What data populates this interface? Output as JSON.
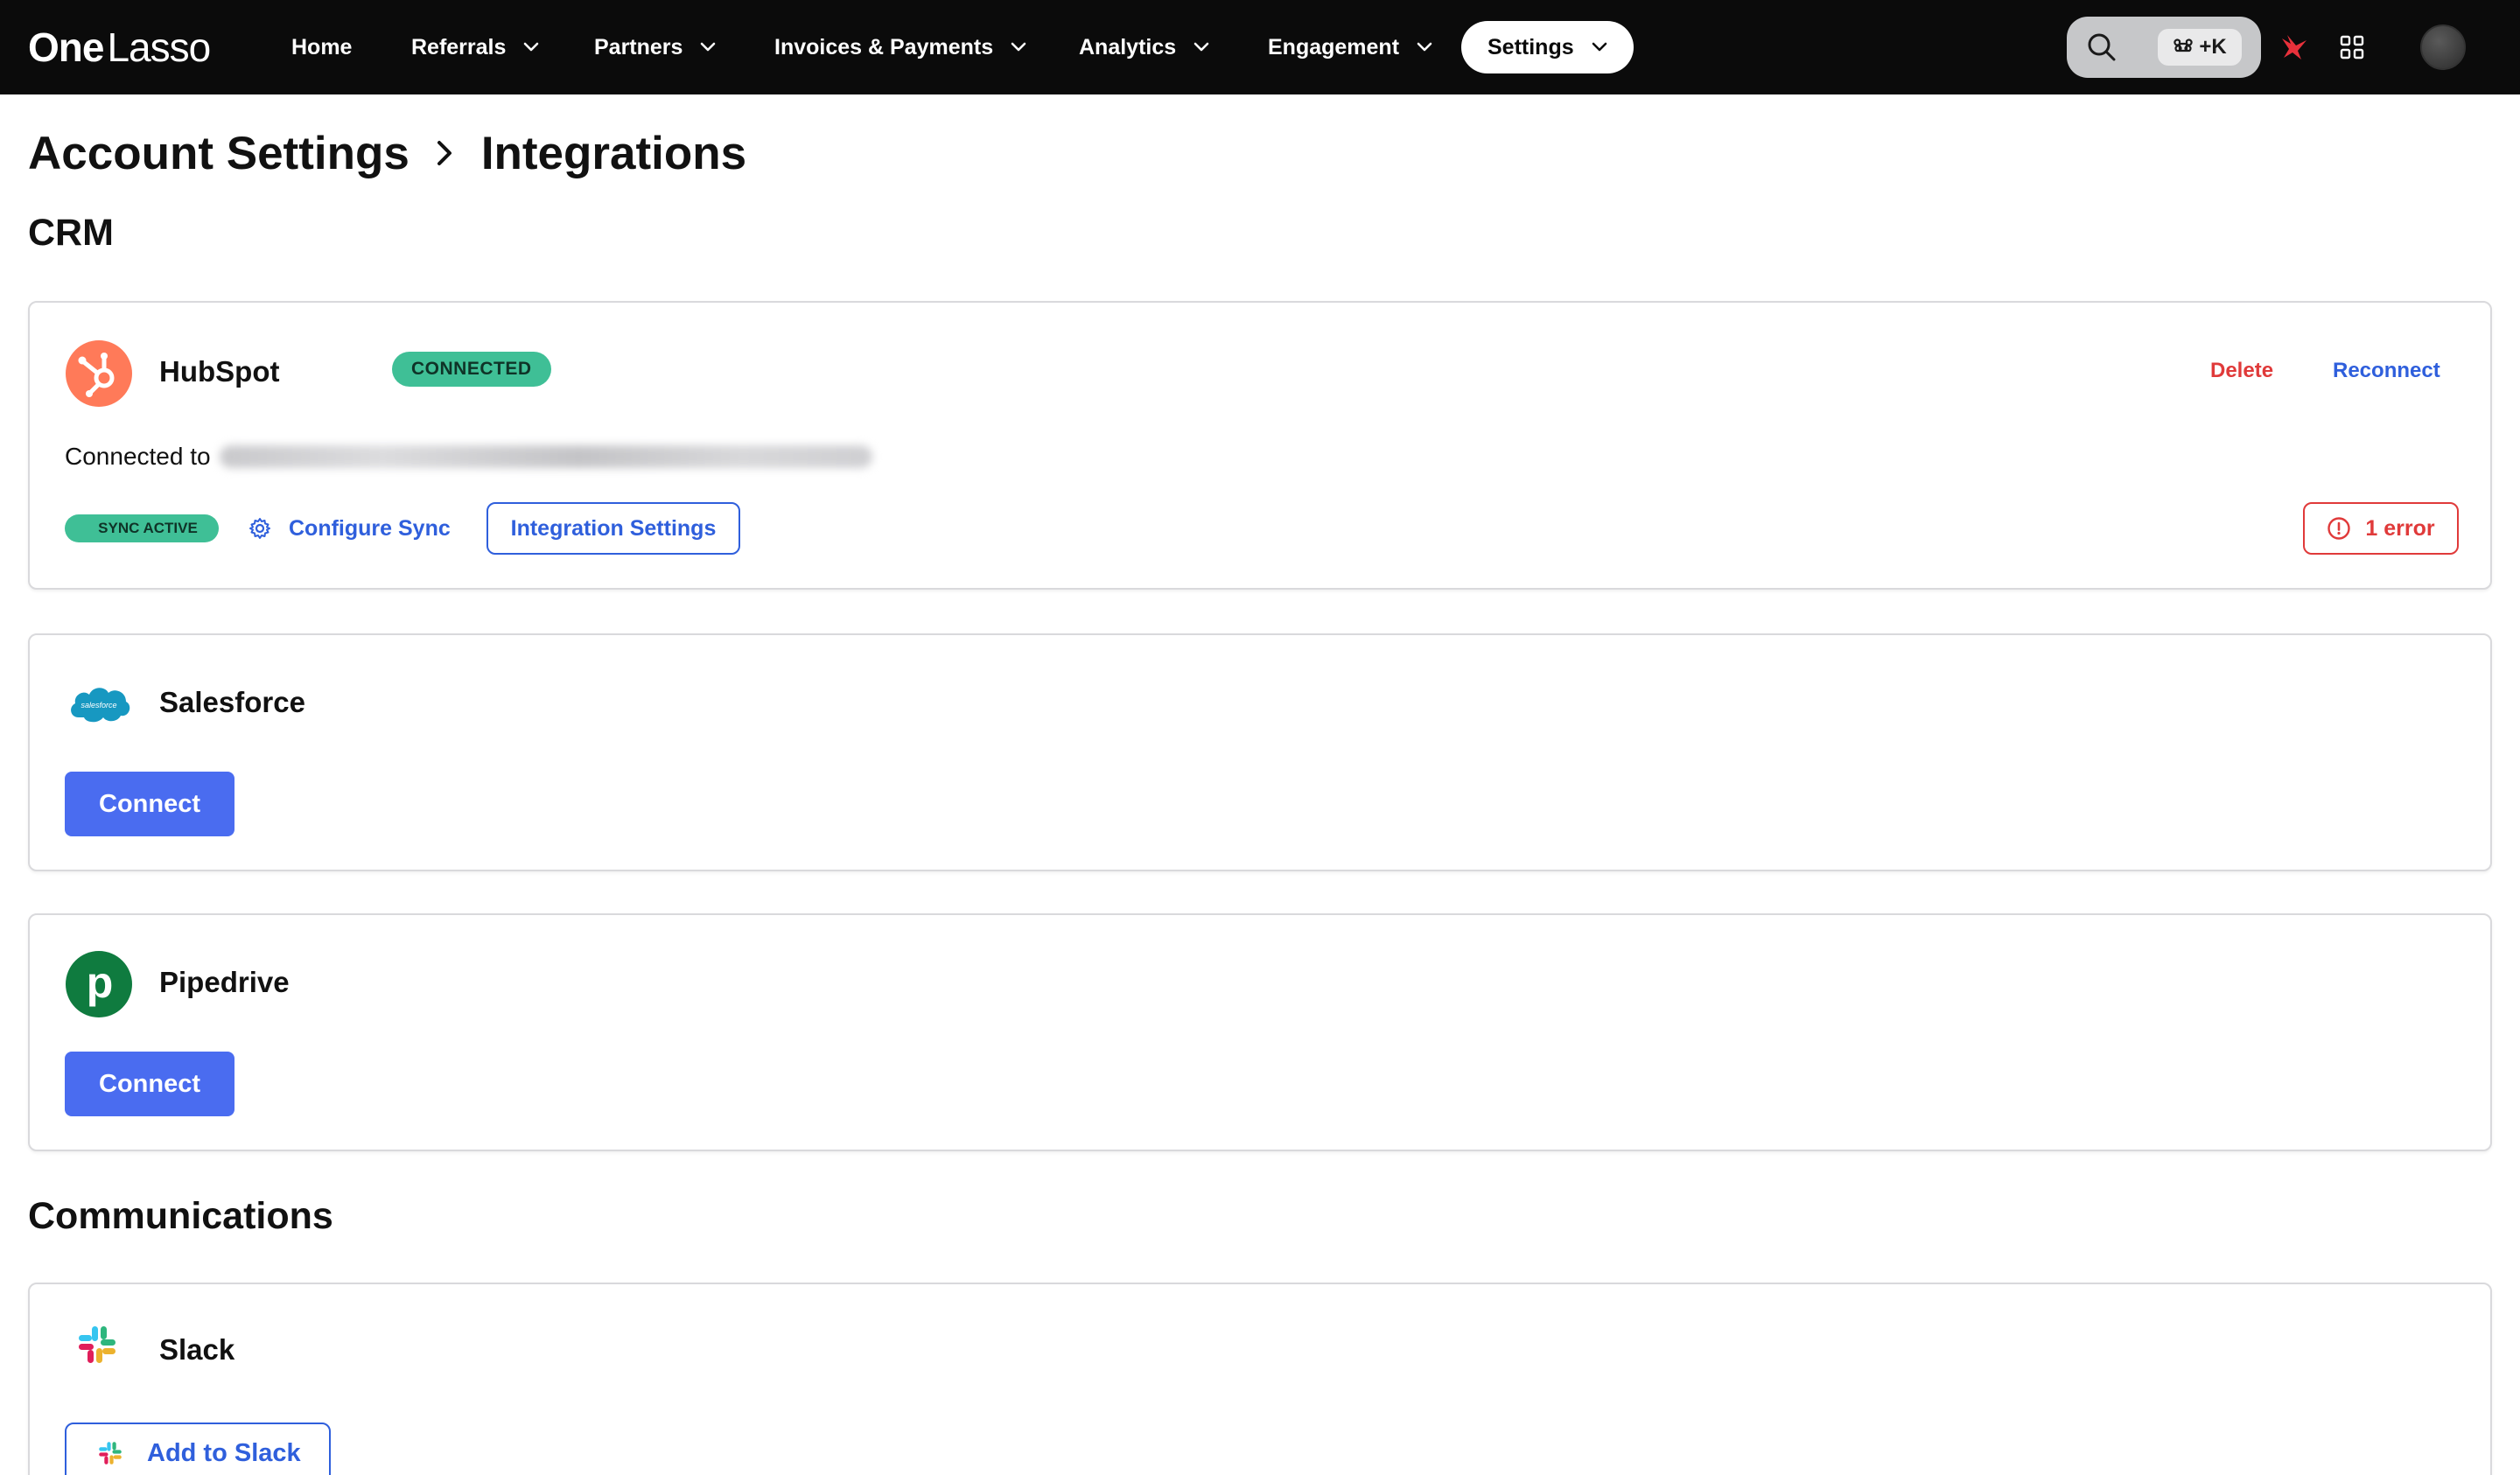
{
  "app": {
    "logo_one": "One",
    "logo_lasso": "Lasso"
  },
  "nav": {
    "items": [
      {
        "label": "Home",
        "has_menu": false
      },
      {
        "label": "Referrals",
        "has_menu": true
      },
      {
        "label": "Partners",
        "has_menu": true
      },
      {
        "label": "Invoices & Payments",
        "has_menu": true
      },
      {
        "label": "Analytics",
        "has_menu": true
      },
      {
        "label": "Engagement",
        "has_menu": true
      },
      {
        "label": "Settings",
        "has_menu": true,
        "active": true
      }
    ],
    "search_shortcut": "+K",
    "icons": [
      "search-icon",
      "command-icon",
      "notification-bird-icon",
      "apps-grid-icon",
      "user-avatar"
    ]
  },
  "breadcrumb": {
    "parent": "Account Settings",
    "current": "Integrations"
  },
  "sections": {
    "crm_title": "CRM",
    "communications_title": "Communications"
  },
  "hubspot": {
    "name": "HubSpot",
    "status": "CONNECTED",
    "delete_label": "Delete",
    "reconnect_label": "Reconnect",
    "connected_to_label": "Connected to",
    "sync_status": "SYNC ACTIVE",
    "configure_label": "Configure Sync",
    "settings_label": "Integration Settings",
    "error_label": "1 error"
  },
  "salesforce": {
    "name": "Salesforce",
    "logo_text": "salesforce",
    "connect_label": "Connect"
  },
  "pipedrive": {
    "name": "Pipedrive",
    "logo_text": "p",
    "connect_label": "Connect"
  },
  "slack": {
    "name": "Slack",
    "add_label": "Add to Slack"
  },
  "colors": {
    "nav_bg": "#0b0b0b",
    "accent_blue": "#4a6cf0",
    "link_blue": "#2f5fdc",
    "success_green": "#3fbf96",
    "danger_red": "#e03a3a",
    "hubspot_orange": "#ff7a59",
    "salesforce_blue": "#1798c1",
    "pipedrive_green": "#0f7b3f"
  }
}
